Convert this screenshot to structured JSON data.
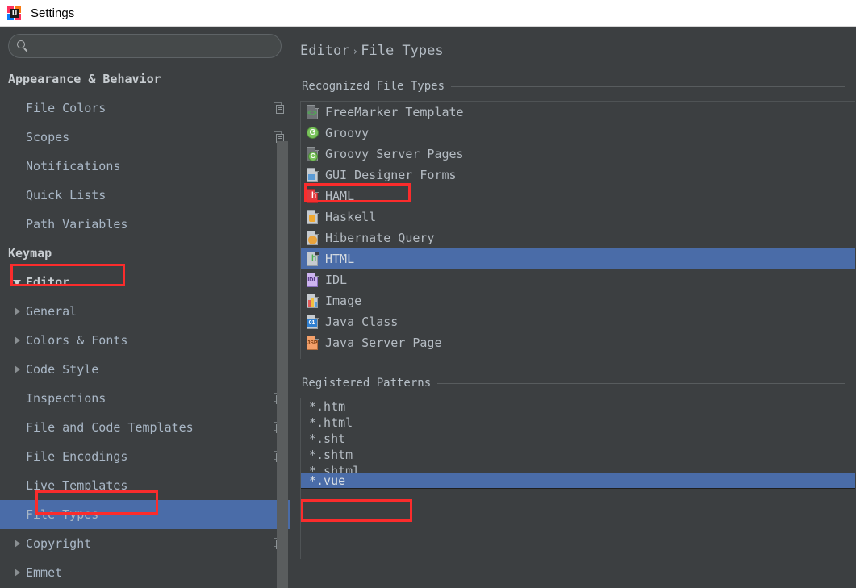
{
  "window": {
    "title": "Settings",
    "app_icon": "intellij-idea-logo"
  },
  "search": {
    "value": "",
    "placeholder": "",
    "icon": "search-icon"
  },
  "sidebar": {
    "items": [
      {
        "label": "Appearance & Behavior",
        "depth": 0,
        "arrow": "none",
        "copy": false,
        "selected": false
      },
      {
        "label": "File Colors",
        "depth": 1,
        "arrow": "none",
        "copy": true,
        "selected": false
      },
      {
        "label": "Scopes",
        "depth": 1,
        "arrow": "none",
        "copy": true,
        "selected": false
      },
      {
        "label": "Notifications",
        "depth": 1,
        "arrow": "none",
        "copy": false,
        "selected": false
      },
      {
        "label": "Quick Lists",
        "depth": 1,
        "arrow": "none",
        "copy": false,
        "selected": false
      },
      {
        "label": "Path Variables",
        "depth": 1,
        "arrow": "none",
        "copy": false,
        "selected": false
      },
      {
        "label": "Keymap",
        "depth": 0,
        "arrow": "none",
        "copy": false,
        "selected": false
      },
      {
        "label": "Editor",
        "depth": 0,
        "arrow": "down",
        "copy": false,
        "selected": false
      },
      {
        "label": "General",
        "depth": 1,
        "arrow": "right",
        "copy": false,
        "selected": false
      },
      {
        "label": "Colors & Fonts",
        "depth": 1,
        "arrow": "right",
        "copy": false,
        "selected": false
      },
      {
        "label": "Code Style",
        "depth": 1,
        "arrow": "right",
        "copy": false,
        "selected": false
      },
      {
        "label": "Inspections",
        "depth": 1,
        "arrow": "none",
        "copy": true,
        "selected": false
      },
      {
        "label": "File and Code Templates",
        "depth": 1,
        "arrow": "none",
        "copy": true,
        "selected": false
      },
      {
        "label": "File Encodings",
        "depth": 1,
        "arrow": "none",
        "copy": true,
        "selected": false
      },
      {
        "label": "Live Templates",
        "depth": 1,
        "arrow": "none",
        "copy": false,
        "selected": false
      },
      {
        "label": "File Types",
        "depth": 1,
        "arrow": "none",
        "copy": false,
        "selected": true
      },
      {
        "label": "Copyright",
        "depth": 1,
        "arrow": "right",
        "copy": true,
        "selected": false
      },
      {
        "label": "Emmet",
        "depth": 1,
        "arrow": "right",
        "copy": false,
        "selected": false
      }
    ]
  },
  "main": {
    "breadcrumb": {
      "parent": "Editor",
      "separator": "›",
      "current": "File Types"
    },
    "recognized_section_title": "Recognized File Types",
    "registered_section_title": "Registered Patterns",
    "file_types": [
      {
        "name": "FreeMarker Template",
        "icon": "freemarker-file-icon",
        "selected": false
      },
      {
        "name": "Groovy",
        "icon": "groovy-file-icon",
        "selected": false
      },
      {
        "name": "Groovy Server Pages",
        "icon": "gsp-file-icon",
        "selected": false
      },
      {
        "name": "GUI Designer Forms",
        "icon": "gui-form-file-icon",
        "selected": false
      },
      {
        "name": "HAML",
        "icon": "haml-file-icon",
        "selected": false
      },
      {
        "name": "Haskell",
        "icon": "haskell-file-icon",
        "selected": false
      },
      {
        "name": "Hibernate Query",
        "icon": "hibernate-file-icon",
        "selected": false
      },
      {
        "name": "HTML",
        "icon": "html-file-icon",
        "selected": true
      },
      {
        "name": "IDL",
        "icon": "idl-file-icon",
        "selected": false
      },
      {
        "name": "Image",
        "icon": "image-file-icon",
        "selected": false
      },
      {
        "name": "Java Class",
        "icon": "java-class-file-icon",
        "selected": false
      },
      {
        "name": "Java Server Page",
        "icon": "jsp-file-icon",
        "selected": false
      }
    ],
    "patterns": [
      {
        "value": "*.htm",
        "selected": false
      },
      {
        "value": "*.html",
        "selected": false
      },
      {
        "value": "*.sht",
        "selected": false
      },
      {
        "value": "*.shtm",
        "selected": false
      },
      {
        "value": "*.shtml",
        "selected": false
      },
      {
        "value": "*.vue",
        "selected": true
      }
    ]
  },
  "annotations": {
    "color": "#fb2c2c",
    "boxes": [
      "editor-tree-node",
      "file-types-tree-node",
      "html-list-row",
      "vue-pattern-row"
    ]
  },
  "theme": {
    "background": "#3c3f41",
    "selection": "#4a6ca8",
    "text": "#b5bcc3",
    "titlebar_background": "#ffffff",
    "annotation_red": "#fb2c2c"
  }
}
